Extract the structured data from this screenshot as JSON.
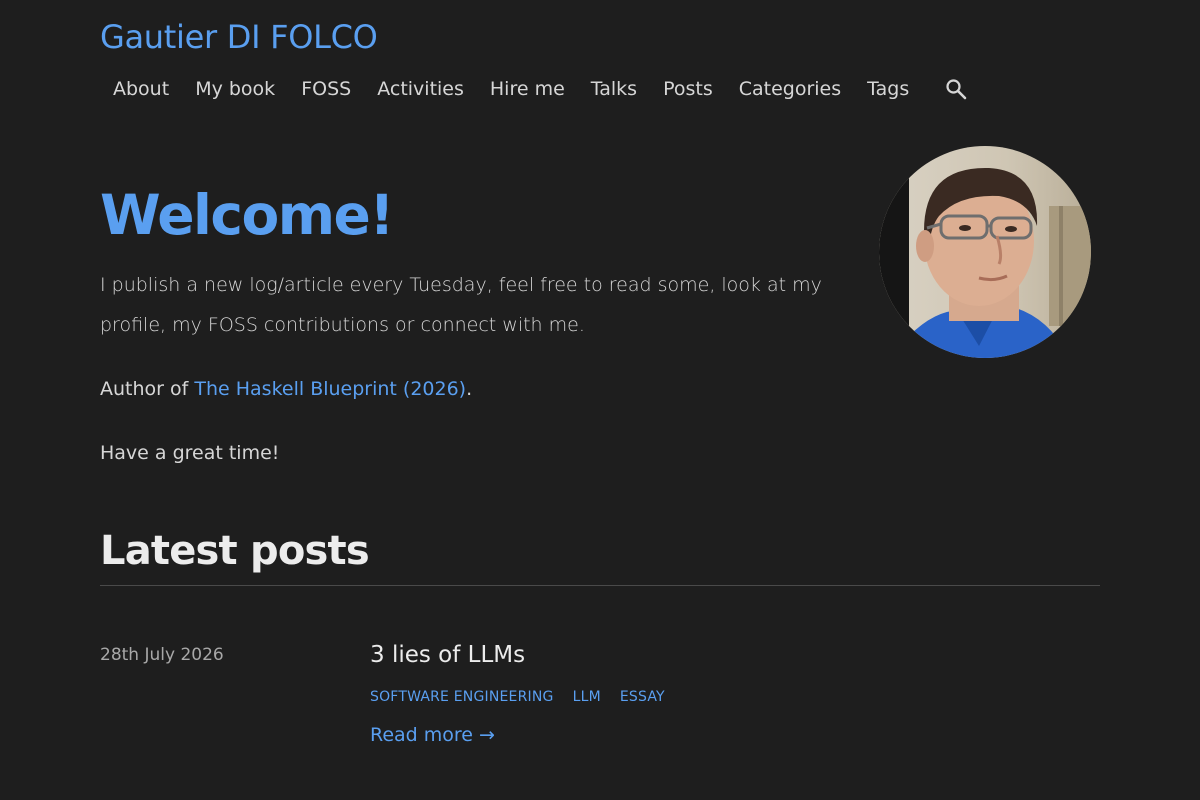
{
  "header": {
    "site_title": "Gautier DI FOLCO"
  },
  "nav": {
    "items": [
      {
        "label": "About"
      },
      {
        "label": "My book"
      },
      {
        "label": "FOSS"
      },
      {
        "label": "Activities"
      },
      {
        "label": "Hire me"
      },
      {
        "label": "Talks"
      },
      {
        "label": "Posts"
      },
      {
        "label": "Categories"
      },
      {
        "label": "Tags"
      }
    ],
    "search_icon": "search-icon"
  },
  "hero": {
    "heading": "Welcome!",
    "intro": "I publish a new log/article every Tuesday, feel free to read some, look at my profile, my FOSS contributions or connect with me.",
    "author_prefix": "Author of ",
    "book_link": "The Haskell Blueprint (2026)",
    "author_suffix": ".",
    "greeting": "Have a great time!"
  },
  "latest": {
    "heading": "Latest posts",
    "posts": [
      {
        "date": "28th July 2026",
        "title": "3 lies of LLMs",
        "tags": [
          "SOFTWARE ENGINEERING",
          "LLM",
          "ESSAY"
        ],
        "read_more": "Read more →"
      }
    ]
  },
  "colors": {
    "background": "#1e1e1e",
    "accent": "#5a9ff0",
    "text": "#d6d6d6",
    "muted": "#a8a8a8"
  }
}
